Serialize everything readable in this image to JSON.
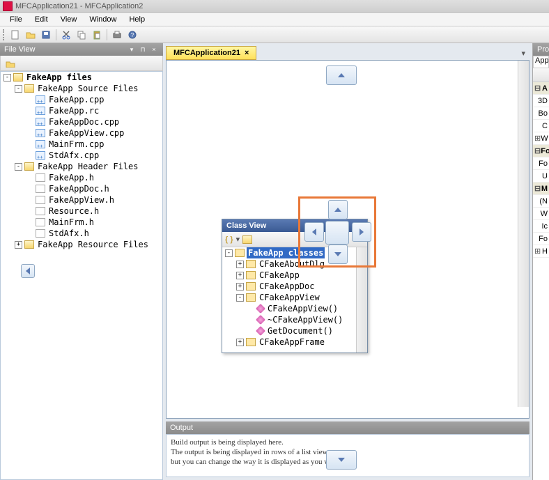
{
  "window": {
    "title": "MFCApplication21 - MFCApplication2"
  },
  "menu": {
    "file": "File",
    "edit": "Edit",
    "view": "View",
    "window": "Window",
    "help": "Help"
  },
  "panels": {
    "fileview": "File View",
    "classview": "Class View",
    "output": "Output",
    "properties": "Prope",
    "appli": "Appli"
  },
  "tab": {
    "active": "MFCApplication21",
    "close": "×"
  },
  "output": {
    "line1": "Build output is being displayed here.",
    "line2": "The output is being displayed in rows of a list view",
    "line3": "but you can change the way it is displayed as you wish..."
  },
  "filetree": {
    "root": "FakeApp files",
    "src_folder": "FakeApp Source Files",
    "src": [
      "FakeApp.cpp",
      "FakeApp.rc",
      "FakeAppDoc.cpp",
      "FakeAppView.cpp",
      "MainFrm.cpp",
      "StdAfx.cpp"
    ],
    "hdr_folder": "FakeApp Header Files",
    "hdr": [
      "FakeApp.h",
      "FakeAppDoc.h",
      "FakeAppView.h",
      "Resource.h",
      "MainFrm.h",
      "StdAfx.h"
    ],
    "res_folder": "FakeApp Resource Files"
  },
  "classtree": {
    "root": "FakeApp classes",
    "items": [
      "CFakeAboutDlg",
      "CFakeApp",
      "CFakeAppDoc",
      "CFakeAppView"
    ],
    "methods": [
      "CFakeAppView()",
      "~CFakeAppView()",
      "GetDocument()"
    ],
    "last": "CFakeAppFrame"
  },
  "props": {
    "rows": [
      {
        "type": "cat",
        "exp": "⊟",
        "label": "A"
      },
      {
        "type": "row",
        "label": "3D"
      },
      {
        "type": "row",
        "label": "Bo"
      },
      {
        "type": "row",
        "label": "C"
      },
      {
        "type": "sub",
        "exp": "⊞",
        "label": "W"
      },
      {
        "type": "cat",
        "exp": "⊟",
        "label": "Fo"
      },
      {
        "type": "row",
        "label": "Fo"
      },
      {
        "type": "row",
        "label": "U"
      },
      {
        "type": "cat",
        "exp": "⊟",
        "label": "M"
      },
      {
        "type": "row",
        "label": "(N"
      },
      {
        "type": "row",
        "label": "W"
      },
      {
        "type": "row",
        "label": "Ic"
      },
      {
        "type": "row",
        "label": "Fo"
      },
      {
        "type": "sub",
        "exp": "⊞",
        "label": "H"
      }
    ]
  },
  "twist": {
    "plus": "+",
    "minus": "-"
  }
}
